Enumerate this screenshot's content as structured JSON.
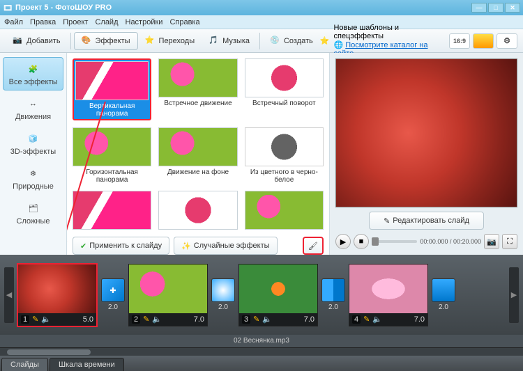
{
  "title": "Проект 5 - ФотоШОУ PRO",
  "menu": [
    "Файл",
    "Правка",
    "Проект",
    "Слайд",
    "Настройки",
    "Справка"
  ],
  "toolbar": {
    "add": "Добавить",
    "effects": "Эффекты",
    "transitions": "Переходы",
    "music": "Музыка",
    "create": "Создать"
  },
  "promo": {
    "line1": "Новые шаблоны и спецэффекты",
    "line2": "Посмотрите каталог на сайте..."
  },
  "aspect": "16:9",
  "sidebar": {
    "items": [
      {
        "label": "Все эффекты"
      },
      {
        "label": "Движения"
      },
      {
        "label": "3D-эффекты"
      },
      {
        "label": "Природные"
      },
      {
        "label": "Сложные"
      }
    ]
  },
  "effects": [
    {
      "label": "Вертикальная панорама"
    },
    {
      "label": "Встречное движение"
    },
    {
      "label": "Встречный поворот"
    },
    {
      "label": "Горизонтальная панорама"
    },
    {
      "label": "Движение на фоне"
    },
    {
      "label": "Из цветного в черно-белое"
    }
  ],
  "actions": {
    "apply": "Применить к слайду",
    "random": "Случайные эффекты"
  },
  "preview": {
    "edit": "Редактировать слайд",
    "time": "00:00.000 / 00:20.000"
  },
  "timeline": {
    "slides": [
      {
        "n": "1",
        "dur": "5.0",
        "trans": "2.0"
      },
      {
        "n": "2",
        "dur": "7.0",
        "trans": "2.0"
      },
      {
        "n": "3",
        "dur": "7.0",
        "trans": "2.0"
      },
      {
        "n": "4",
        "dur": "7.0",
        "trans": "2.0"
      }
    ],
    "audio": "02 Веснянка.mp3"
  },
  "tabs": {
    "slides": "Слайды",
    "timeline": "Шкала времени"
  }
}
